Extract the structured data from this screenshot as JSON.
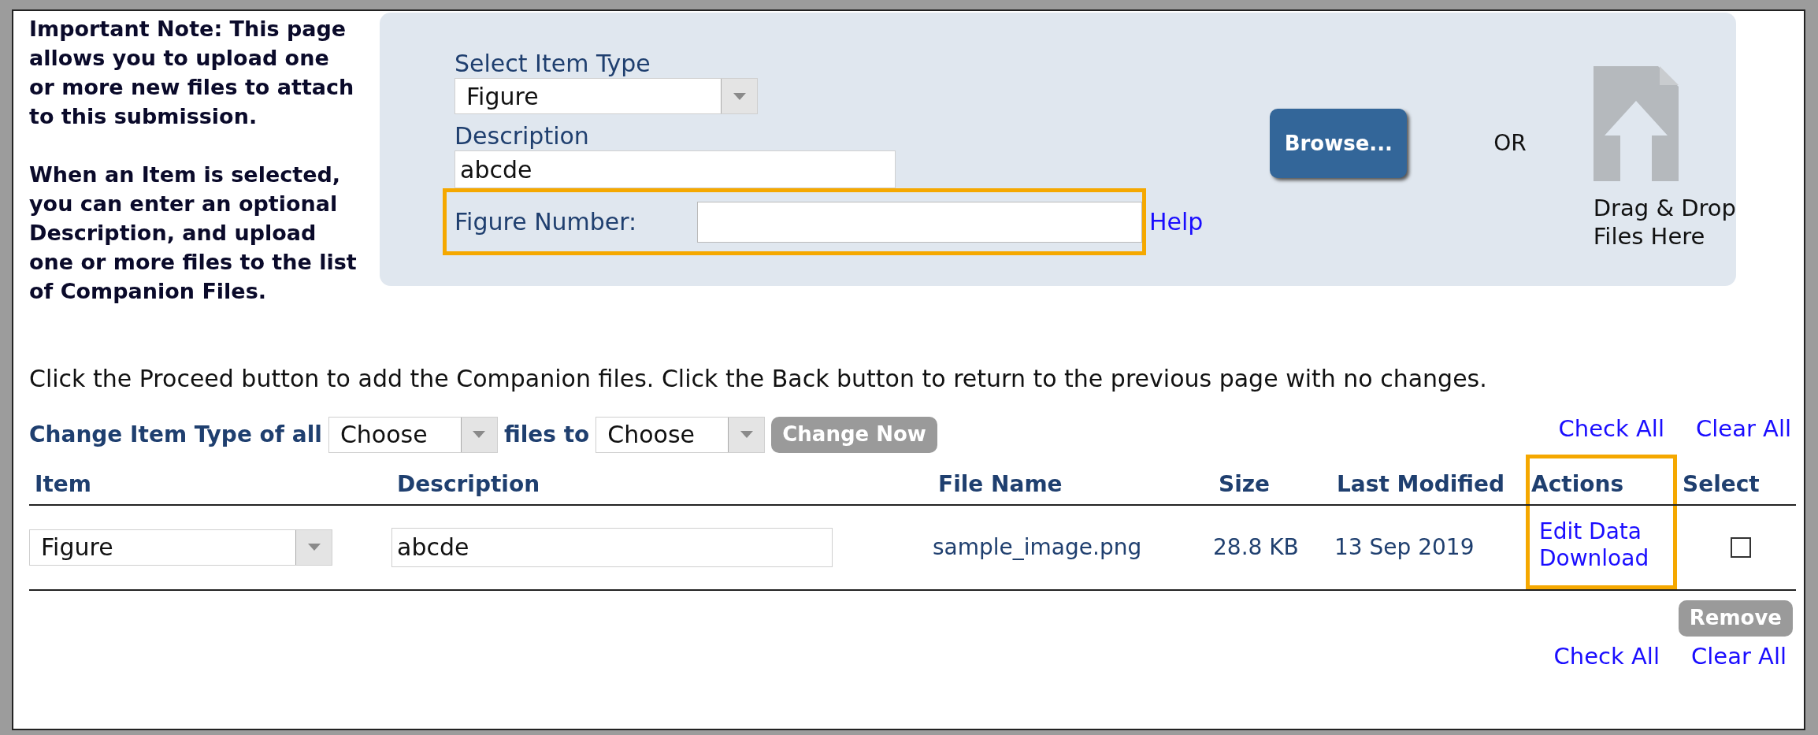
{
  "note": [
    "Important Note: This page allows you to upload one or more new files to attach to this submission.",
    "When an Item is selected, you can enter an optional Description, and upload one or more files to the list of Companion Files."
  ],
  "upload_panel": {
    "item_type": {
      "label": "Select Item Type",
      "value": "Figure"
    },
    "description": {
      "label": "Description",
      "value": "abcde"
    },
    "figure_number": {
      "label": "Figure Number:",
      "highlighted": true
    },
    "help_link": "Help",
    "browse_button": "Browse...",
    "separator": "OR",
    "drop_zone": [
      "Drag & Drop",
      "Files Here"
    ]
  },
  "instructions": "Click the Proceed button to add the Companion files. Click the Back button to return to the previous page with no changes.",
  "bulk_change": {
    "label": "Change Item Type of all",
    "from": "Choose",
    "middle": "files to",
    "to": "Choose",
    "button": "Change Now",
    "button_disabled": true
  },
  "select_links_top": [
    "Check All",
    "Clear All"
  ],
  "table": {
    "columns": [
      {
        "label": "Item",
        "highlighted": false
      },
      {
        "label": "Description",
        "highlighted": false
      },
      {
        "label": "File Name",
        "highlighted": false
      },
      {
        "label": "Size",
        "highlighted": false
      },
      {
        "label": "Last Modified",
        "highlighted": false
      },
      {
        "label": "Actions",
        "highlighted": true
      },
      {
        "label": "Select",
        "highlighted": false
      }
    ],
    "rows": [
      {
        "item": "Figure",
        "description": "abcde",
        "file_name": "sample_image.png",
        "size": "28.8 KB",
        "last_modified": "13 Sep 2019",
        "actions": [
          "Edit Data",
          "Download"
        ],
        "selected": false
      }
    ]
  },
  "remove_button": {
    "label": "Remove",
    "disabled": true
  },
  "select_links_bottom": [
    "Check All",
    "Clear All"
  ]
}
